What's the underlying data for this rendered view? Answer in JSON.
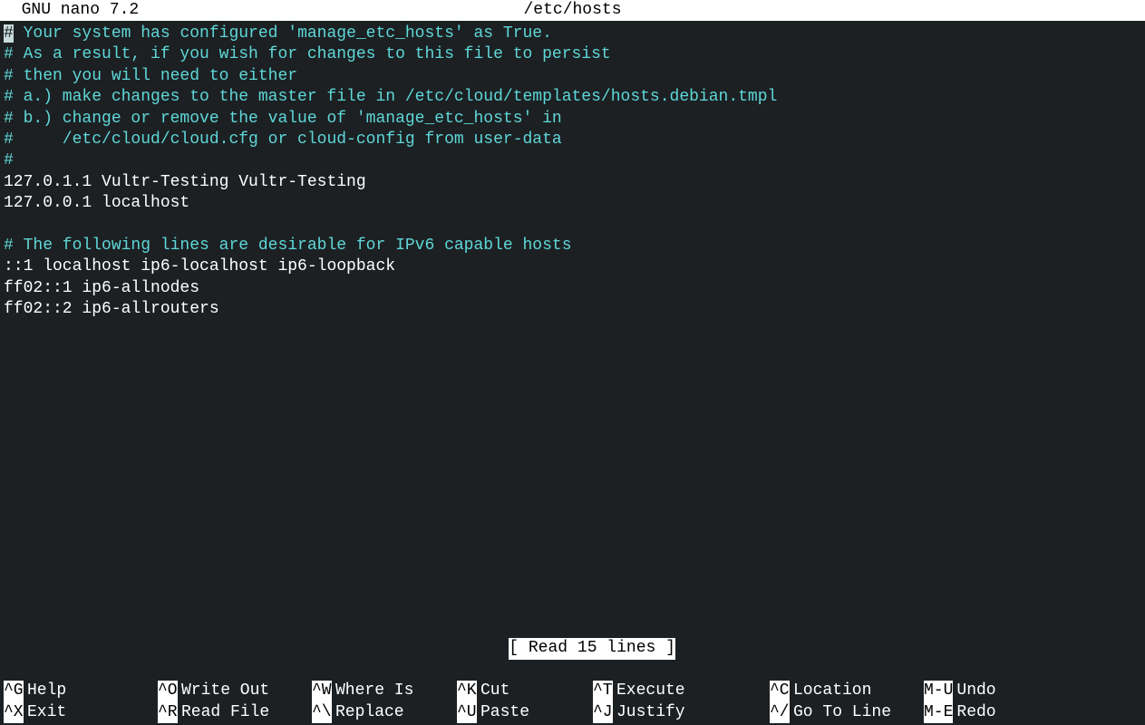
{
  "titlebar": {
    "app": "  GNU nano 7.2",
    "filename": "/etc/hosts"
  },
  "editor": {
    "cursor_char": "#",
    "lines": [
      {
        "type": "comment",
        "text": " Your system has configured 'manage_etc_hosts' as True.",
        "has_cursor": true
      },
      {
        "type": "comment",
        "text": "# As a result, if you wish for changes to this file to persist"
      },
      {
        "type": "comment",
        "text": "# then you will need to either"
      },
      {
        "type": "comment",
        "text": "# a.) make changes to the master file in /etc/cloud/templates/hosts.debian.tmpl"
      },
      {
        "type": "comment",
        "text": "# b.) change or remove the value of 'manage_etc_hosts' in"
      },
      {
        "type": "comment",
        "text": "#     /etc/cloud/cloud.cfg or cloud-config from user-data"
      },
      {
        "type": "comment",
        "text": "#"
      },
      {
        "type": "normal",
        "text": "127.0.1.1 Vultr-Testing Vultr-Testing"
      },
      {
        "type": "normal",
        "text": "127.0.0.1 localhost"
      },
      {
        "type": "normal",
        "text": ""
      },
      {
        "type": "comment",
        "text": "# The following lines are desirable for IPv6 capable hosts"
      },
      {
        "type": "normal",
        "text": "::1 localhost ip6-localhost ip6-loopback"
      },
      {
        "type": "normal",
        "text": "ff02::1 ip6-allnodes"
      },
      {
        "type": "normal",
        "text": "ff02::2 ip6-allrouters"
      }
    ]
  },
  "status": {
    "message": "[ Read 15 lines ]"
  },
  "shortcuts": {
    "rows": [
      [
        {
          "key": "^G",
          "label": "Help"
        },
        {
          "key": "^O",
          "label": "Write Out"
        },
        {
          "key": "^W",
          "label": "Where Is"
        },
        {
          "key": "^K",
          "label": "Cut"
        },
        {
          "key": "^T",
          "label": "Execute"
        },
        {
          "key": "^C",
          "label": "Location"
        },
        {
          "key": "M-U",
          "label": "Undo"
        }
      ],
      [
        {
          "key": "^X",
          "label": "Exit"
        },
        {
          "key": "^R",
          "label": "Read File"
        },
        {
          "key": "^\\",
          "label": "Replace"
        },
        {
          "key": "^U",
          "label": "Paste"
        },
        {
          "key": "^J",
          "label": "Justify"
        },
        {
          "key": "^/",
          "label": "Go To Line"
        },
        {
          "key": "M-E",
          "label": "Redo"
        }
      ]
    ]
  }
}
